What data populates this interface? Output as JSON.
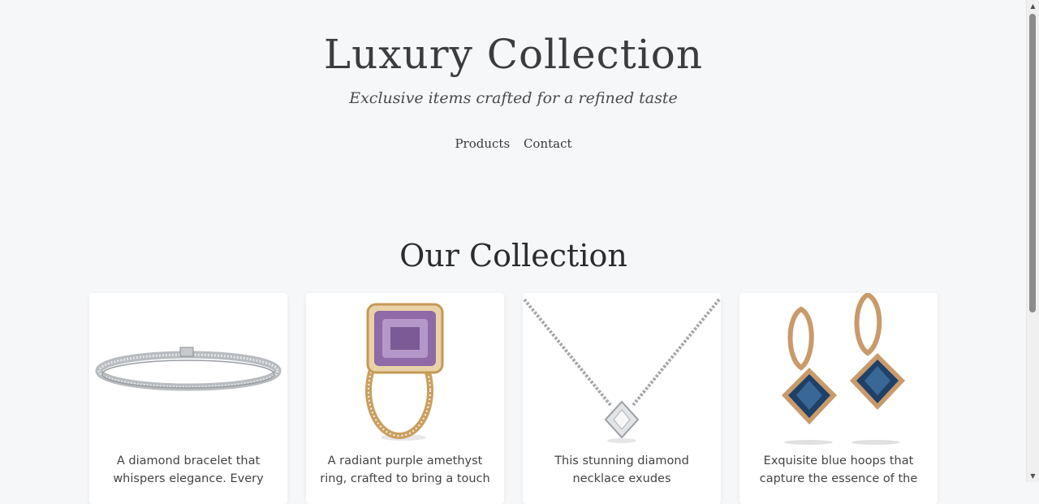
{
  "header": {
    "title": "Luxury Collection",
    "tagline": "Exclusive items crafted for a refined taste"
  },
  "nav": {
    "items": [
      "Products",
      "Contact"
    ]
  },
  "collection": {
    "title": "Our Collection",
    "cards": [
      {
        "image": "diamond-bracelet",
        "text": "A diamond bracelet that whispers elegance. Every"
      },
      {
        "image": "amethyst-ring",
        "text": "A radiant purple amethyst ring, crafted to bring a touch"
      },
      {
        "image": "diamond-necklace",
        "text": "This stunning diamond necklace exudes"
      },
      {
        "image": "blue-earrings",
        "text": "Exquisite blue hoops that capture the essence of the"
      }
    ]
  },
  "scrollbar": {
    "up_icon": "triangle-up",
    "down_icon": "triangle-down",
    "position": 0
  },
  "colors": {
    "background": "#f6f7f9",
    "text": "#3c3c3c",
    "card": "#ffffff"
  }
}
